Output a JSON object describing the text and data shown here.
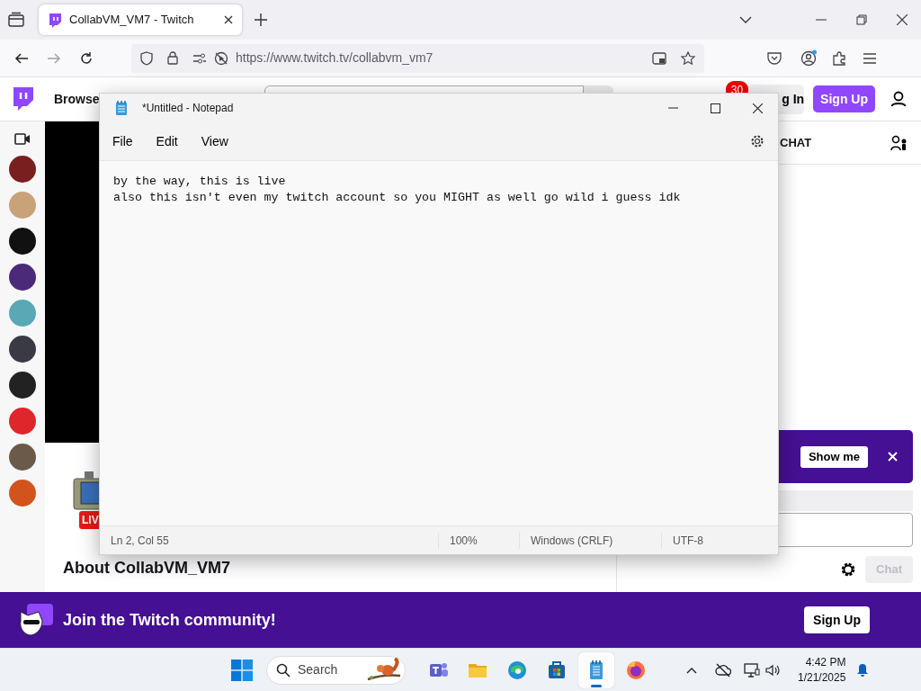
{
  "browser": {
    "tab": {
      "title": "CollabVM_VM7 - Twitch",
      "selected": true
    },
    "nav_buttons": [
      {
        "kind": "back",
        "disabled": false
      },
      {
        "kind": "forward",
        "disabled": true
      },
      {
        "kind": "reload",
        "disabled": false
      }
    ],
    "url": "https://www.twitch.tv/collabvm_vm7"
  },
  "twitch": {
    "nav": {
      "browse": "Browse",
      "notification_count": "30",
      "login": "g In",
      "signup": "Sign Up"
    },
    "sidebar": {
      "channels": [
        {
          "color": "#7a1f1f"
        },
        {
          "color": "#c9a27a"
        },
        {
          "color": "#111111"
        },
        {
          "color": "#4b2a7a"
        },
        {
          "color": "#5aa7b5"
        },
        {
          "color": "#3a3a45"
        },
        {
          "color": "#222222"
        },
        {
          "color": "#e0262a"
        },
        {
          "color": "#6b5a4a"
        },
        {
          "color": "#d2541c"
        }
      ]
    },
    "live_badge": "LIV",
    "about": "About CollabVM_VM7",
    "chat": {
      "header": "CHAT",
      "promo_button": "Show me",
      "send_button": "Chat",
      "send_disabled": true
    },
    "banner": {
      "text": "Join the Twitch community!",
      "signup": "Sign Up"
    }
  },
  "notepad": {
    "title": "*Untitled - Notepad",
    "menus": [
      "File",
      "Edit",
      "View"
    ],
    "lines": [
      "by the way, this is live",
      "also this isn't even my twitch account so you MIGHT as well go wild i guess idk"
    ],
    "status": [
      "Ln 2, Col 55",
      "100%",
      "Windows (CRLF)",
      "UTF-8"
    ]
  },
  "taskbar": {
    "search_placeholder": "Search",
    "apps": [
      {
        "kind": "teams",
        "selected": false
      },
      {
        "kind": "explorer",
        "selected": false
      },
      {
        "kind": "edge",
        "selected": false
      },
      {
        "kind": "store",
        "selected": false
      },
      {
        "kind": "notepad",
        "selected": true
      },
      {
        "kind": "firefox",
        "selected": false
      }
    ],
    "time": "4:42 PM",
    "date": "1/21/2025"
  }
}
